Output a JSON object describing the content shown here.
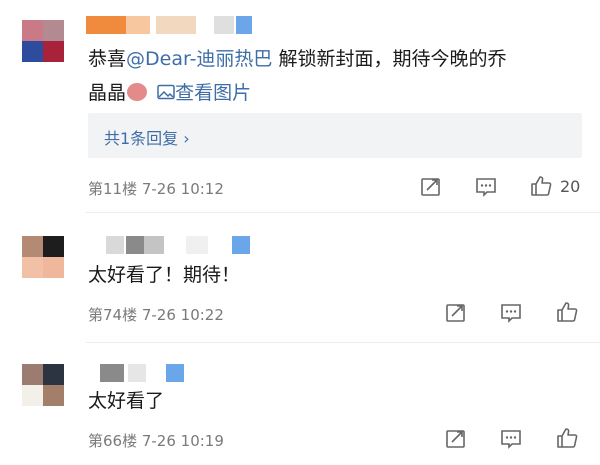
{
  "comments": [
    {
      "text_prefix": "恭喜",
      "mention": "@Dear-迪丽热巴",
      "text_line1_rest": " 解锁新封面，期待今晚的乔",
      "text_line2": "晶晶",
      "view_image": "查看图片",
      "reply_label": "共1条回复 ›",
      "meta": "第11楼  7-26 10:12",
      "like_count": "20"
    },
    {
      "text": "太好看了！期待！",
      "meta": "第74楼  7-26 10:22"
    },
    {
      "text": "太好看了",
      "meta": "第66楼  7-26 10:19"
    }
  ],
  "icons": [
    "share-icon",
    "comment-icon",
    "like-icon",
    "image-icon"
  ],
  "colors": {
    "link": "#3e6ea8",
    "meta": "#7a7a7a",
    "reply_bg": "#f2f3f5"
  }
}
